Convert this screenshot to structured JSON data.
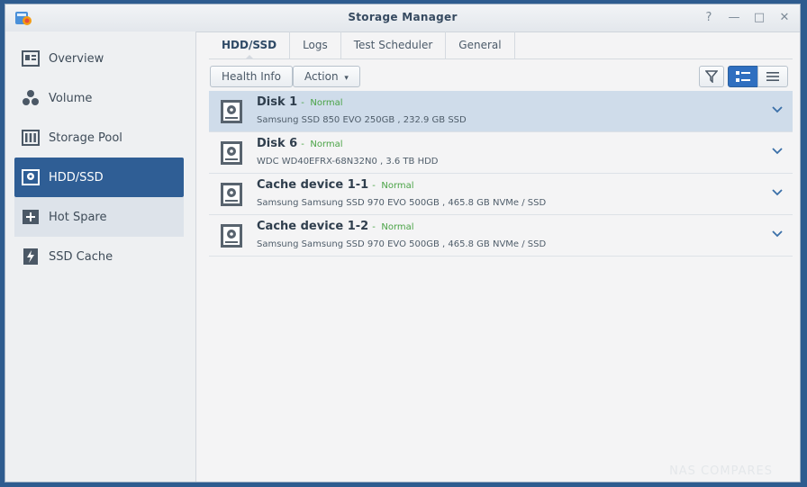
{
  "window": {
    "title": "Storage Manager",
    "controls": [
      "?",
      "—",
      "□",
      "✕"
    ]
  },
  "sidebar": {
    "items": [
      {
        "label": "Overview",
        "icon": "overview-icon"
      },
      {
        "label": "Volume",
        "icon": "volume-icon"
      },
      {
        "label": "Storage Pool",
        "icon": "storage-pool-icon"
      },
      {
        "label": "HDD/SSD",
        "icon": "hdd-icon",
        "active": true
      },
      {
        "label": "Hot Spare",
        "icon": "hot-spare-icon"
      },
      {
        "label": "SSD Cache",
        "icon": "ssd-cache-icon"
      }
    ]
  },
  "tabs": [
    {
      "label": "HDD/SSD",
      "active": true
    },
    {
      "label": "Logs"
    },
    {
      "label": "Test Scheduler"
    },
    {
      "label": "General"
    }
  ],
  "toolbar": {
    "health_info_label": "Health Info",
    "action_label": "Action",
    "action_caret": "▾"
  },
  "disks": [
    {
      "name": "Disk 1",
      "sep": "-",
      "status": "Normal",
      "desc": "Samsung SSD 850 EVO 250GB , 232.9 GB SSD",
      "selected": true
    },
    {
      "name": "Disk 6",
      "sep": "-",
      "status": "Normal",
      "desc": "WDC WD40EFRX-68N32N0 , 3.6 TB HDD"
    },
    {
      "name": "Cache device 1-1",
      "sep": "-",
      "status": "Normal",
      "desc": "Samsung Samsung SSD 970 EVO 500GB , 465.8 GB NVMe / SSD"
    },
    {
      "name": "Cache device 1-2",
      "sep": "-",
      "status": "Normal",
      "desc": "Samsung Samsung SSD 970 EVO 500GB , 465.8 GB NVMe / SSD"
    }
  ],
  "watermark": "NAS COMPARES",
  "colors": {
    "accent": "#2f5e95",
    "status_normal": "#4aa346",
    "selected_row": "#cfdcea"
  }
}
